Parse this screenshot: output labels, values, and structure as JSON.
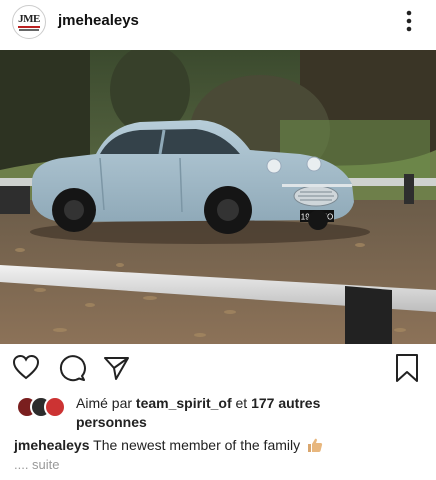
{
  "header": {
    "avatar_text": "JME",
    "username": "jmehealeys"
  },
  "photo": {
    "plate_text": "191 AUO",
    "car_color": "#a3bccb"
  },
  "actions": {
    "icons": [
      "heart-icon",
      "comment-icon",
      "share-icon",
      "bookmark-icon"
    ]
  },
  "likes": {
    "prefix": "Aimé par",
    "liker": "team_spirit_of",
    "joiner": "et",
    "others": "177 autres",
    "others_line2": "personnes"
  },
  "caption": {
    "username": "jmehealeys",
    "text": "The newest member of the family",
    "more": ".... suite"
  }
}
